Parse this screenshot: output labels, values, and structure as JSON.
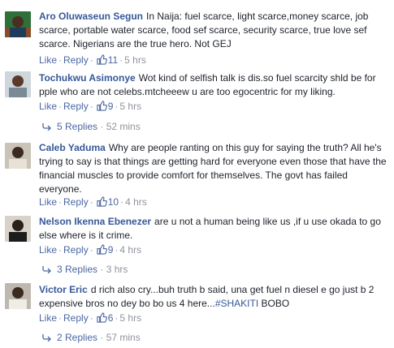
{
  "comments": [
    {
      "author": "Aro Oluwaseun Segun",
      "text": "In Naija: fuel scarce, light scarce,money scarce, job scarce, portable water scarce, food sef scarce, security scarce, true love sef scarce. Nigerians are the true hero. Not GEJ",
      "like": "Like",
      "reply": "Reply",
      "likes": "11",
      "time": "5 hrs"
    },
    {
      "author": "Tochukwu Asimonye",
      "text": "Wot kind of selfish talk is dis.so fuel scarcity shld be for pple who are not celebs.mtcheeew u are too egocentric for my liking.",
      "like": "Like",
      "reply": "Reply",
      "likes": "9",
      "time": "5 hrs",
      "replies": "5 Replies",
      "replies_time": "52 mins"
    },
    {
      "author": "Caleb Yaduma",
      "text": "Why are people ranting on this guy for saying the truth? All he's trying to say is that things are getting hard for everyone even those that have the financial muscles to provide comfort for themselves. The govt has failed everyone.",
      "like": "Like",
      "reply": "Reply",
      "likes": "10",
      "time": "4 hrs"
    },
    {
      "author": "Nelson Ikenna Ebenezer",
      "text": "are u not a human being like us ,if u use okada to go else where is it crime.",
      "like": "Like",
      "reply": "Reply",
      "likes": "9",
      "time": "4 hrs",
      "replies": "3 Replies",
      "replies_time": "3 hrs"
    },
    {
      "author": "Victor Eric",
      "text": "d rich also cry...buh truth b said, una get fuel n diesel e go just b 2 expensive bros no dey bo bo us 4 here...",
      "hashtag": "#SHAKITI",
      "text_after": " BOBO",
      "like": "Like",
      "reply": "Reply",
      "likes": "6",
      "time": "5 hrs",
      "replies": "2 Replies",
      "replies_time": "57 mins"
    }
  ],
  "colors": {
    "link": "#365899",
    "meta": "#90949c",
    "text": "#1d2129"
  }
}
